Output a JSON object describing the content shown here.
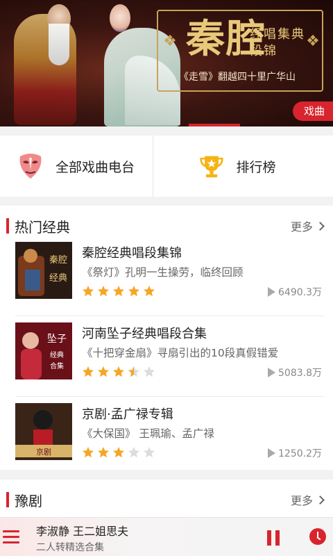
{
  "banner": {
    "title_main": "秦腔",
    "title_sub": "经唱集典段锦",
    "caption": "《走雪》翻越四十里广华山",
    "tag": "戏曲"
  },
  "quick": [
    {
      "label": "全部戏曲电台",
      "icon": "opera-mask-icon"
    },
    {
      "label": "排行榜",
      "icon": "trophy-icon"
    }
  ],
  "section_classic": {
    "title": "热门经典",
    "more": "更多",
    "items": [
      {
        "title": "秦腔经典唱段集锦",
        "subtitle": "《祭灯》孔明一生操劳，临终回顾",
        "rating": 5,
        "plays": "6490.3万"
      },
      {
        "title": "河南坠子经典唱段合集",
        "subtitle": "《十把穿金扇》寻扇引出的10段真假错爱",
        "rating": 3.5,
        "plays": "5083.8万"
      },
      {
        "title": "京剧·孟广禄专辑",
        "subtitle": "《大保国》 王珮瑜、孟广禄",
        "rating": 3,
        "plays": "1250.2万"
      }
    ]
  },
  "section_yu": {
    "title": "豫剧",
    "more": "更多"
  },
  "player": {
    "track": "李淑静 王二姐思夫",
    "source": "二人转精选合集"
  },
  "colors": {
    "accent": "#d8242e",
    "star": "#f5a623"
  }
}
